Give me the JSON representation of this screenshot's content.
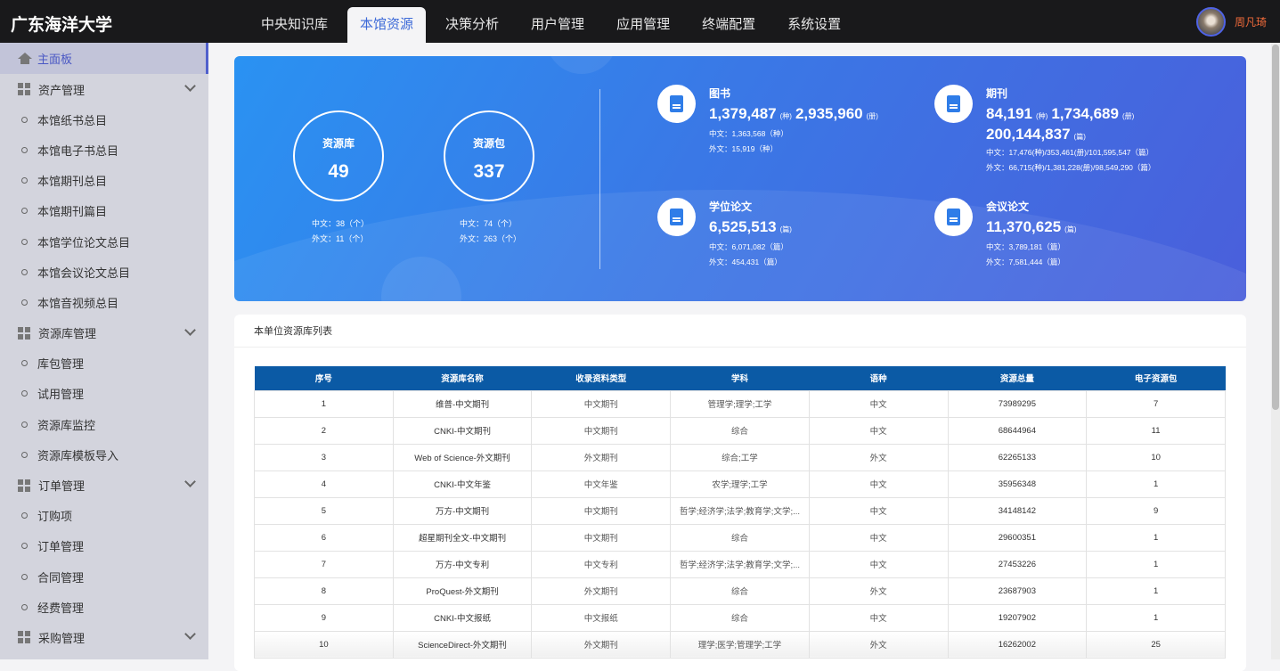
{
  "header": {
    "logo": "广东海洋大学",
    "tabs": [
      "中央知识库",
      "本馆资源",
      "决策分析",
      "用户管理",
      "应用管理",
      "终端配置",
      "系统设置"
    ],
    "active_tab": 1,
    "user": "周凡琦"
  },
  "sidebar": {
    "items": [
      {
        "type": "home",
        "label": "主面板"
      },
      {
        "type": "group",
        "label": "资产管理"
      },
      {
        "type": "sub",
        "label": "本馆纸书总目"
      },
      {
        "type": "sub",
        "label": "本馆电子书总目"
      },
      {
        "type": "sub",
        "label": "本馆期刊总目"
      },
      {
        "type": "sub",
        "label": "本馆期刊篇目"
      },
      {
        "type": "sub",
        "label": "本馆学位论文总目"
      },
      {
        "type": "sub",
        "label": "本馆会议论文总目"
      },
      {
        "type": "sub",
        "label": "本馆音视频总目"
      },
      {
        "type": "group",
        "label": "资源库管理"
      },
      {
        "type": "sub",
        "label": "库包管理"
      },
      {
        "type": "sub",
        "label": "试用管理"
      },
      {
        "type": "sub",
        "label": "资源库监控"
      },
      {
        "type": "sub",
        "label": "资源库模板导入"
      },
      {
        "type": "group",
        "label": "订单管理"
      },
      {
        "type": "sub",
        "label": "订购项"
      },
      {
        "type": "sub",
        "label": "订单管理"
      },
      {
        "type": "sub",
        "label": "合同管理"
      },
      {
        "type": "sub",
        "label": "经费管理"
      },
      {
        "type": "group",
        "label": "采购管理"
      }
    ]
  },
  "banner": {
    "db": {
      "label": "资源库",
      "value": "49",
      "zh": "中文：38（个）",
      "fo": "外文：11（个）"
    },
    "pkg": {
      "label": "资源包",
      "value": "337",
      "zh": "中文：74（个）",
      "fo": "外文：263（个）"
    },
    "books": {
      "title": "图书",
      "v1": "1,379,487",
      "u1": "(种)",
      "v2": "2,935,960",
      "u2": "(册)",
      "zh": "中文：1,363,568（种）",
      "fo": "外文：15,919（种）"
    },
    "journals": {
      "title": "期刊",
      "v1": "84,191",
      "u1": "(种)",
      "v2": "1,734,689",
      "u2": "(册)",
      "v3": "200,144,837",
      "u3": "(篇)",
      "zh": "中文：17,476(种)/353,461(册)/101,595,547（篇）",
      "fo": "外文：66,715(种)/1,381,228(册)/98,549,290（篇）"
    },
    "theses": {
      "title": "学位论文",
      "v1": "6,525,513",
      "u1": "(篇)",
      "zh": "中文：6,071,082（篇）",
      "fo": "外文：454,431（篇）"
    },
    "conf": {
      "title": "会议论文",
      "v1": "11,370,625",
      "u1": "(篇)",
      "zh": "中文：3,789,181（篇）",
      "fo": "外文：7,581,444（篇）"
    }
  },
  "table": {
    "title": "本单位资源库列表",
    "columns": [
      "序号",
      "资源库名称",
      "收录资料类型",
      "学科",
      "语种",
      "资源总量",
      "电子资源包"
    ],
    "rows": [
      [
        "1",
        "维普-中文期刊",
        "中文期刊",
        "管理学;理学;工学",
        "中文",
        "73989295",
        "7"
      ],
      [
        "2",
        "CNKI-中文期刊",
        "中文期刊",
        "综合",
        "中文",
        "68644964",
        "11"
      ],
      [
        "3",
        "Web of Science-外文期刊",
        "外文期刊",
        "综合;工学",
        "外文",
        "62265133",
        "10"
      ],
      [
        "4",
        "CNKI-中文年鉴",
        "中文年鉴",
        "农学;理学;工学",
        "中文",
        "35956348",
        "1"
      ],
      [
        "5",
        "万方-中文期刊",
        "中文期刊",
        "哲学;经济学;法学;教育学;文学;...",
        "中文",
        "34148142",
        "9"
      ],
      [
        "6",
        "超星期刊全文-中文期刊",
        "中文期刊",
        "综合",
        "中文",
        "29600351",
        "1"
      ],
      [
        "7",
        "万方-中文专利",
        "中文专利",
        "哲学;经济学;法学;教育学;文学;...",
        "中文",
        "27453226",
        "1"
      ],
      [
        "8",
        "ProQuest-外文期刊",
        "外文期刊",
        "综合",
        "外文",
        "23687903",
        "1"
      ],
      [
        "9",
        "CNKI-中文报纸",
        "中文报纸",
        "综合",
        "中文",
        "19207902",
        "1"
      ],
      [
        "10",
        "ScienceDirect-外文期刊",
        "外文期刊",
        "理学;医学;管理学;工学",
        "外文",
        "16262002",
        "25"
      ]
    ]
  }
}
